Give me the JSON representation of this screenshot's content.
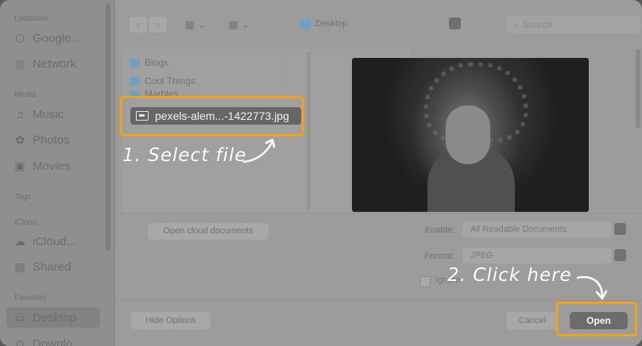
{
  "sidebar": {
    "sections": {
      "locations": "Locations",
      "media": "Media",
      "tags": "Tags",
      "icloud": "iCloud",
      "favorites": "Favorites"
    },
    "locations": [
      {
        "label": "Google...",
        "icon": "drive-icon"
      },
      {
        "label": "Network",
        "icon": "network-icon"
      }
    ],
    "media": [
      {
        "label": "Music",
        "icon": "music-icon"
      },
      {
        "label": "Photos",
        "icon": "photos-icon"
      },
      {
        "label": "Movies",
        "icon": "movies-icon"
      }
    ],
    "icloud": [
      {
        "label": "iCloud...",
        "icon": "cloud-icon"
      },
      {
        "label": "Shared",
        "icon": "shared-icon"
      }
    ],
    "favorites": [
      {
        "label": "Desktop",
        "icon": "desktop-icon",
        "selected": true
      },
      {
        "label": "Downlo...",
        "icon": "download-icon"
      }
    ]
  },
  "toolbar": {
    "back": "‹",
    "forward": "›",
    "location": "Desktop",
    "search_placeholder": "Search"
  },
  "browser": {
    "items": [
      {
        "label": "Blogs",
        "type": "folder"
      },
      {
        "label": "Cool Things",
        "type": "folder"
      },
      {
        "label": "Marbles",
        "type": "folder"
      }
    ],
    "selected_file": "pexels-alem...-1422773.jpg"
  },
  "options": {
    "cloud_button": "Open cloud documents",
    "enable_label": "Enable:",
    "enable_value": "All Readable Documents",
    "format_label": "Format:",
    "format_value": "JPEG",
    "checkbox_label": "Ignore"
  },
  "buttons": {
    "hide_options": "Hide Options",
    "cancel": "Cancel",
    "open": "Open"
  },
  "annotations": {
    "step1": "1. Select file",
    "step2": "2. Click here",
    "highlight_color": "#f0a21a"
  }
}
